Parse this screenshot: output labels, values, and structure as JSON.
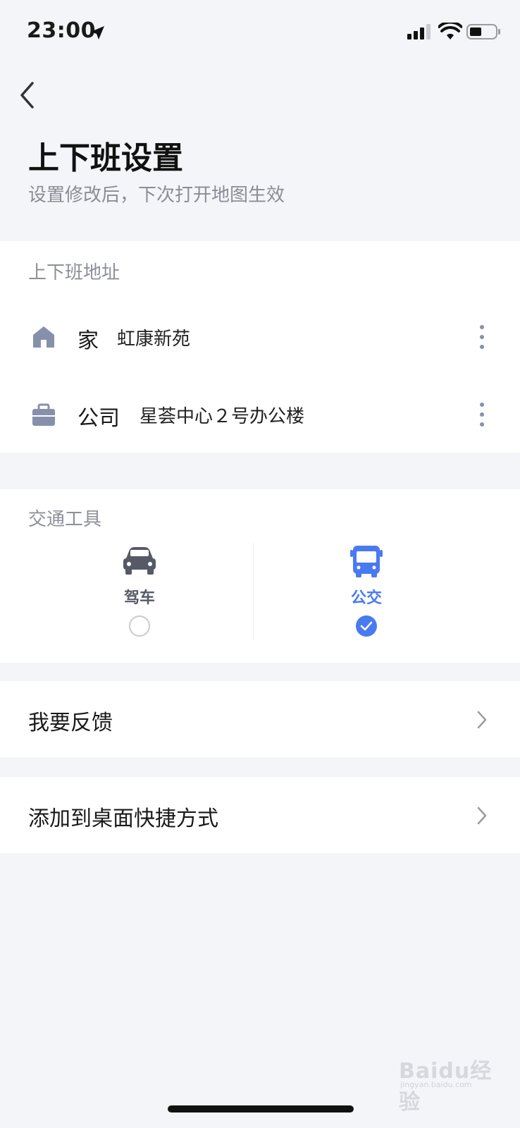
{
  "status_bar": {
    "time": "23:00"
  },
  "header": {
    "title": "上下班设置",
    "subtitle": "设置修改后，下次打开地图生效"
  },
  "addresses": {
    "section_label": "上下班地址",
    "home": {
      "name": "家",
      "value": "虹康新苑",
      "icon": "home-icon"
    },
    "company": {
      "name": "公司",
      "value": "星荟中心２号办公楼",
      "icon": "briefcase-icon"
    }
  },
  "transport": {
    "section_label": "交通工具",
    "options": [
      {
        "label": "驾车",
        "icon": "car-icon",
        "selected": false
      },
      {
        "label": "公交",
        "icon": "bus-icon",
        "selected": true
      }
    ],
    "selected_color": "#4a7af0",
    "unselected_color": "#555a66"
  },
  "menu": {
    "feedback_label": "我要反馈",
    "shortcut_label": "添加到桌面快捷方式"
  },
  "watermark": {
    "text": "Baidu经验",
    "sub": "jingyan.baidu.com"
  }
}
